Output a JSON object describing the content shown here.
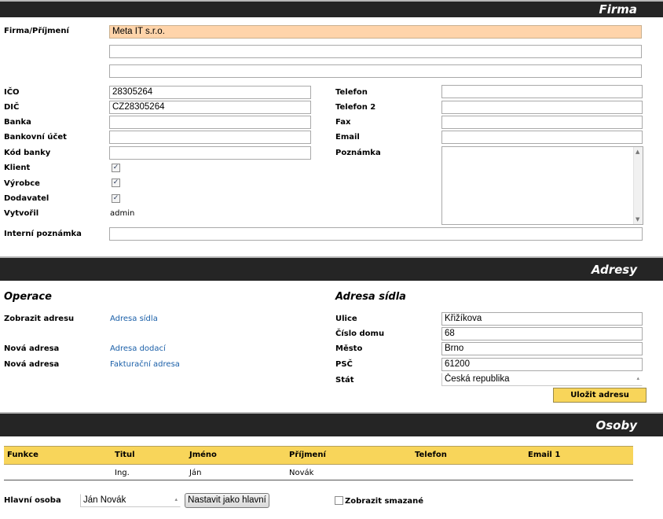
{
  "firma": {
    "header": "Firma",
    "name_label": "Firma/Příjmení",
    "name_value": "Meta IT s.r.o.",
    "name2_value": "",
    "name3_value": "",
    "ico_label": "IČO",
    "ico_value": "28305264",
    "dic_label": "DIČ",
    "dic_value": "CZ28305264",
    "banka_label": "Banka",
    "banka_value": "",
    "ucet_label": "Bankovní účet",
    "ucet_value": "",
    "kod_label": "Kód banky",
    "kod_value": "",
    "klient_label": "Klient",
    "klient_checked": true,
    "vyrobce_label": "Výrobce",
    "vyrobce_checked": true,
    "dodavatel_label": "Dodavatel",
    "dodavatel_checked": true,
    "vytvoril_label": "Vytvořil",
    "vytvoril_value": "admin",
    "telefon_label": "Telefon",
    "telefon_value": "",
    "telefon2_label": "Telefon 2",
    "telefon2_value": "",
    "fax_label": "Fax",
    "fax_value": "",
    "email_label": "Email",
    "email_value": "",
    "poznamka_label": "Poznámka",
    "poznamka_value": "",
    "interni_label": "Interní poznámka",
    "interni_value": "",
    "check_glyph": "✓"
  },
  "adresy": {
    "header": "Adresy",
    "operace_title": "Operace",
    "zobrazit_label": "Zobrazit adresu",
    "zobrazit_link": "Adresa sídla",
    "nova1_label": "Nová adresa",
    "nova1_link": "Adresa dodací",
    "nova2_label": "Nová adresa",
    "nova2_link": "Fakturační adresa",
    "sidlo_title": "Adresa sídla",
    "ulice_label": "Ulice",
    "ulice_value": "Křižíkova",
    "cislo_label": "Číslo domu",
    "cislo_value": "68",
    "mesto_label": "Město",
    "mesto_value": "Brno",
    "psc_label": "PSČ",
    "psc_value": "61200",
    "stat_label": "Stát",
    "stat_value": "Česká republika",
    "save_button": "Uložit adresu"
  },
  "osoby": {
    "header": "Osoby",
    "columns": [
      "Funkce",
      "Titul",
      "Jméno",
      "Příjmení",
      "Telefon",
      "Email 1"
    ],
    "rows": [
      {
        "funkce": "",
        "titul": "Ing.",
        "jmeno": "Ján",
        "prijmeni": "Novák",
        "telefon": "",
        "email": ""
      }
    ],
    "hlavni_label": "Hlavní osoba",
    "hlavni_value": "Ján Novák",
    "nastavit_button": "Nastavit jako hlavní",
    "smazane_label": "Zobrazit smazané",
    "smazane_checked": false
  },
  "colors": {
    "header_bg": "#252525",
    "highlight_input": "#ffd4aa",
    "table_header": "#f8d55a",
    "link": "#1a5fa8"
  }
}
